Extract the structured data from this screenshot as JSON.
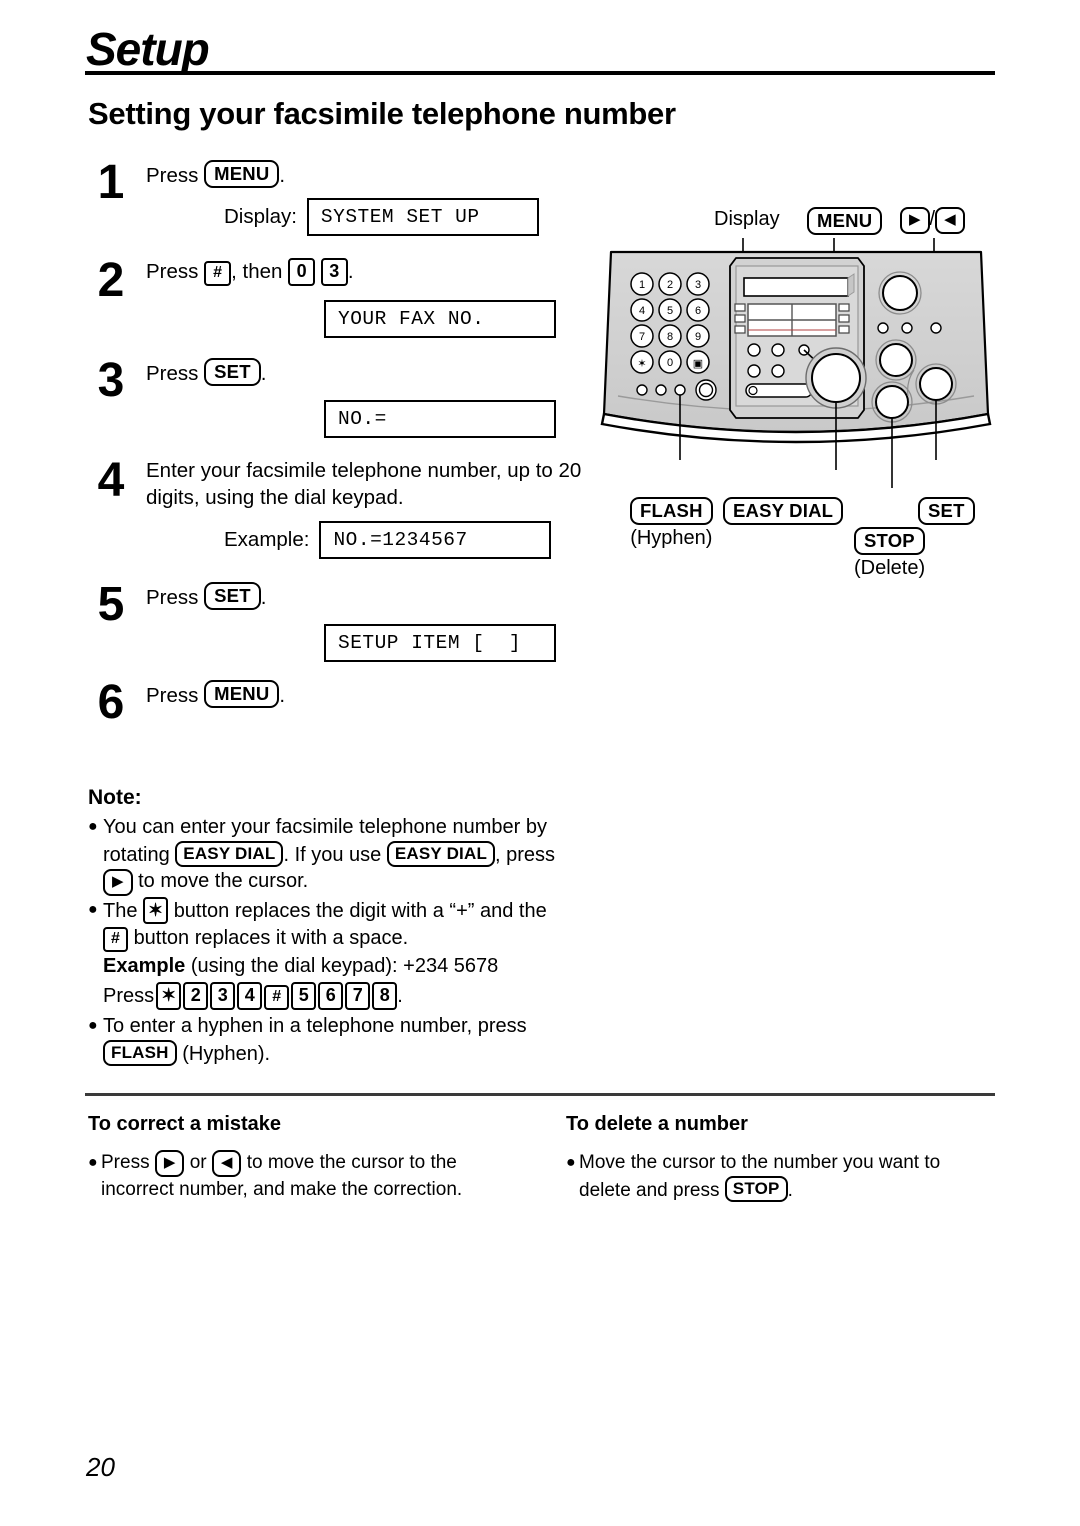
{
  "chapter": "Setup",
  "section_title": "Setting your facsimile telephone number",
  "page_number": "20",
  "steps": [
    {
      "num": "1",
      "text_before": "Press",
      "button": "MENU",
      "text_after": ".",
      "lcd_label": "Display:",
      "lcd": "SYSTEM SET UP"
    },
    {
      "num": "2",
      "text_before": "Press",
      "key1": "#",
      "text_mid": ", then",
      "key2": "0",
      "key3": "3",
      "text_after": ".",
      "lcd_label": "",
      "lcd": "YOUR FAX NO."
    },
    {
      "num": "3",
      "text_before": "Press",
      "button": "SET",
      "text_after": ".",
      "lcd_label": "",
      "lcd": "NO.="
    },
    {
      "num": "4",
      "text": "Enter your facsimile telephone number, up to 20 digits, using the dial keypad.",
      "lcd_label": "Example:",
      "lcd": "NO.=1234567"
    },
    {
      "num": "5",
      "text_before": "Press",
      "button": "SET",
      "text_after": ".",
      "lcd_label": "",
      "lcd": "SETUP ITEM [  ]"
    },
    {
      "num": "6",
      "text_before": "Press",
      "button": "MENU",
      "text_after": "."
    }
  ],
  "note": {
    "heading": "Note:",
    "item1_a": "You can enter your facsimile telephone number by",
    "item1_b_pre": "rotating",
    "item1_btn1": "EASY DIAL",
    "item1_b_mid": ". If you use",
    "item1_btn2": "EASY DIAL",
    "item1_b_post": ", press",
    "item1_c_post": "to move the cursor.",
    "item2_pre": "The",
    "item2_key": "✶",
    "item2_mid": "button replaces the digit with a “+” and the",
    "item2_key2": "#",
    "item2_post": "button replaces it with a space.",
    "example_label": "Example",
    "example_text": "(using the dial keypad):  +234  5678",
    "press_label": "Press",
    "press_keys": [
      "✶",
      "2",
      "3",
      "4",
      "#",
      "5",
      "6",
      "7",
      "8"
    ],
    "press_end": ".",
    "item3_a": "To enter a hyphen in a telephone number, press",
    "item3_btn": "FLASH",
    "item3_b": "(Hyphen)."
  },
  "correct": {
    "heading": "To correct a mistake",
    "pre": "Press",
    "btn_right": "▶",
    "mid": "or",
    "btn_left": "◀",
    "post": "to move the cursor to the incorrect number, and make the correction."
  },
  "delete": {
    "heading": "To delete a number",
    "pre": "Move the cursor to the number you want to delete and press",
    "btn": "STOP",
    "post": "."
  },
  "device": {
    "callout_display": "Display",
    "callout_menu": "MENU",
    "callout_right_arrow": "▶",
    "callout_slash": "/",
    "callout_left_arrow": "◀",
    "callout_flash": "FLASH",
    "callout_flash_sub": "(Hyphen)",
    "callout_easy_dial": "EASY DIAL",
    "callout_set": "SET",
    "callout_stop": "STOP",
    "callout_stop_sub": "(Delete)",
    "keypad": [
      "1",
      "2",
      "3",
      "4",
      "5",
      "6",
      "7",
      "8",
      "9",
      "✶",
      "0",
      "▣"
    ]
  }
}
